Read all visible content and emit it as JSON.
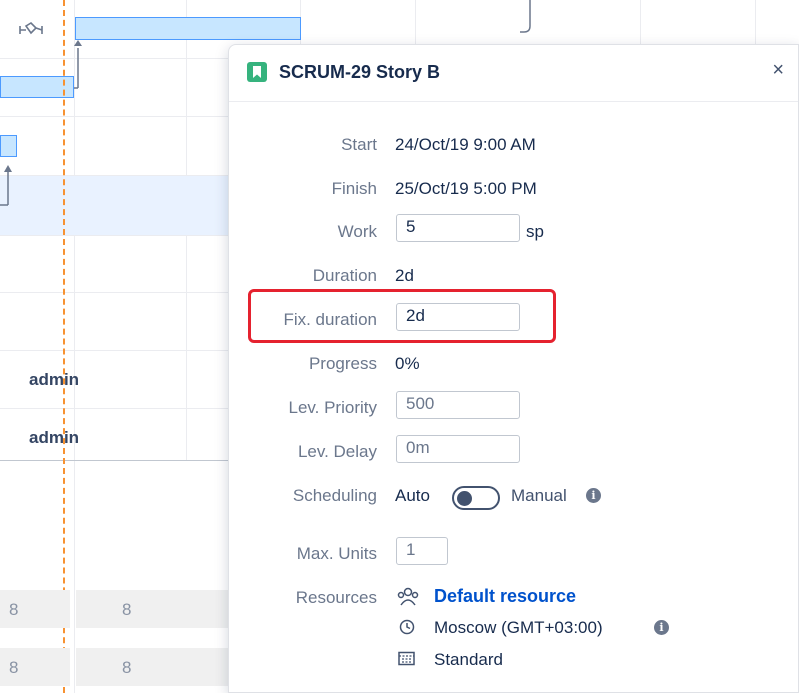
{
  "gantt": {
    "assignees": [
      "admin",
      "admin"
    ],
    "cells_row1": [
      "8",
      "8"
    ],
    "cells_row2": [
      "8",
      "8"
    ],
    "link_icon": "link-arrows-icon"
  },
  "panel": {
    "issue_key_title": "SCRUM-29 Story B",
    "issue_icon": "story-bookmark-icon",
    "close_label": "×",
    "start_label": "Start",
    "start_value": "24/Oct/19 9:00 AM",
    "finish_label": "Finish",
    "finish_value": "25/Oct/19 5:00 PM",
    "work_label": "Work",
    "work_value": "5",
    "work_unit": "sp",
    "duration_label": "Duration",
    "duration_value": "2d",
    "fix_duration_label": "Fix. duration",
    "fix_duration_value": "2d",
    "progress_label": "Progress",
    "progress_value": "0%",
    "lev_priority_label": "Lev. Priority",
    "lev_priority_placeholder": "500",
    "lev_delay_label": "Lev. Delay",
    "lev_delay_placeholder": "0m",
    "scheduling_label": "Scheduling",
    "scheduling_auto": "Auto",
    "scheduling_manual": "Manual",
    "max_units_label": "Max. Units",
    "max_units_placeholder": "1",
    "resources_label": "Resources",
    "resource_name": "Default resource",
    "timezone": "Moscow (GMT+03:00)",
    "calendar": "Standard",
    "info_glyph": "i"
  }
}
